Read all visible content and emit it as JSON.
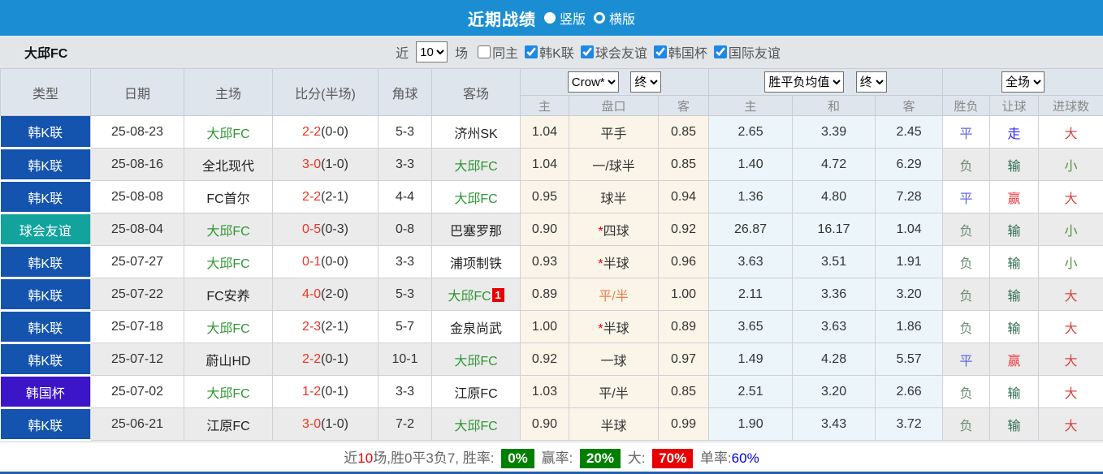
{
  "topbar": {
    "title": "近期战绩",
    "options": [
      {
        "label": "竖版",
        "selected": true
      },
      {
        "label": "横版",
        "selected": false
      }
    ]
  },
  "filterbar": {
    "team": "大邱FC",
    "near_label": "近",
    "near_value": "10",
    "games_label": "场",
    "checkboxes": [
      {
        "label": "同主",
        "checked": false
      },
      {
        "label": "韩K联",
        "checked": true
      },
      {
        "label": "球会友谊",
        "checked": true
      },
      {
        "label": "韩国杯",
        "checked": true
      },
      {
        "label": "国际友谊",
        "checked": true
      }
    ]
  },
  "table": {
    "main_headers": [
      "类型",
      "日期",
      "主场",
      "比分(半场)",
      "角球",
      "客场"
    ],
    "selects": {
      "company": "Crow*",
      "company_period": "终",
      "average": "胜平负均值",
      "average_period": "终",
      "scope": "全场"
    },
    "sub_headers": [
      "主",
      "盘口",
      "客",
      "主",
      "和",
      "客",
      "胜负",
      "让球",
      "进球数"
    ],
    "type_colors": {
      "韩K联": "#1453ae",
      "球会友谊": "#12a39c",
      "韩国杯": "#3d15c8"
    },
    "result_colors": {
      "平": "#6268e0",
      "负": "#6e8c72",
      "走": "#2b2bf0",
      "输": "#2f6e52",
      "赢": "#e8414d",
      "大": "#de4040",
      "小": "#52923e"
    },
    "rows": [
      {
        "type": "韩K联",
        "date": "25-08-23",
        "home": "大邱FC",
        "home_green": true,
        "score": "2-2",
        "half": "(0-0)",
        "corner": "5-3",
        "away": "济州SK",
        "away_green": false,
        "away_badge": "",
        "h_odds": "1.04",
        "handicap": "平手",
        "handicap_star": false,
        "handicap_orange": false,
        "a_odds": "0.85",
        "avg_h": "2.65",
        "avg_d": "3.39",
        "avg_a": "2.45",
        "result": "平",
        "handicap_result": "走",
        "goals": "大"
      },
      {
        "type": "韩K联",
        "date": "25-08-16",
        "home": "全北现代",
        "home_green": false,
        "score": "3-0",
        "half": "(1-0)",
        "corner": "3-3",
        "away": "大邱FC",
        "away_green": true,
        "away_badge": "",
        "h_odds": "1.04",
        "handicap": "一/球半",
        "handicap_star": false,
        "handicap_orange": false,
        "a_odds": "0.85",
        "avg_h": "1.40",
        "avg_d": "4.72",
        "avg_a": "6.29",
        "result": "负",
        "handicap_result": "输",
        "goals": "小"
      },
      {
        "type": "韩K联",
        "date": "25-08-08",
        "home": "FC首尔",
        "home_green": false,
        "score": "2-2",
        "half": "(2-1)",
        "corner": "4-4",
        "away": "大邱FC",
        "away_green": true,
        "away_badge": "",
        "h_odds": "0.95",
        "handicap": "球半",
        "handicap_star": false,
        "handicap_orange": false,
        "a_odds": "0.94",
        "avg_h": "1.36",
        "avg_d": "4.80",
        "avg_a": "7.28",
        "result": "平",
        "handicap_result": "赢",
        "goals": "大"
      },
      {
        "type": "球会友谊",
        "date": "25-08-04",
        "home": "大邱FC",
        "home_green": true,
        "score": "0-5",
        "half": "(0-3)",
        "corner": "0-8",
        "away": "巴塞罗那",
        "away_green": false,
        "away_badge": "",
        "h_odds": "0.90",
        "handicap": "四球",
        "handicap_star": true,
        "handicap_orange": false,
        "a_odds": "0.92",
        "avg_h": "26.87",
        "avg_d": "16.17",
        "avg_a": "1.04",
        "result": "负",
        "handicap_result": "输",
        "goals": "小"
      },
      {
        "type": "韩K联",
        "date": "25-07-27",
        "home": "大邱FC",
        "home_green": true,
        "score": "0-1",
        "half": "(0-0)",
        "corner": "3-3",
        "away": "浦项制铁",
        "away_green": false,
        "away_badge": "",
        "h_odds": "0.93",
        "handicap": "半球",
        "handicap_star": true,
        "handicap_orange": false,
        "a_odds": "0.96",
        "avg_h": "3.63",
        "avg_d": "3.51",
        "avg_a": "1.91",
        "result": "负",
        "handicap_result": "输",
        "goals": "小"
      },
      {
        "type": "韩K联",
        "date": "25-07-22",
        "home": "FC安养",
        "home_green": false,
        "score": "4-0",
        "half": "(2-0)",
        "corner": "5-3",
        "away": "大邱FC",
        "away_green": true,
        "away_badge": "1",
        "h_odds": "0.89",
        "handicap": "平/半",
        "handicap_star": false,
        "handicap_orange": true,
        "a_odds": "1.00",
        "avg_h": "2.11",
        "avg_d": "3.36",
        "avg_a": "3.20",
        "result": "负",
        "handicap_result": "输",
        "goals": "大"
      },
      {
        "type": "韩K联",
        "date": "25-07-18",
        "home": "大邱FC",
        "home_green": true,
        "score": "2-3",
        "half": "(2-1)",
        "corner": "5-7",
        "away": "金泉尚武",
        "away_green": false,
        "away_badge": "",
        "h_odds": "1.00",
        "handicap": "半球",
        "handicap_star": true,
        "handicap_orange": false,
        "a_odds": "0.89",
        "avg_h": "3.65",
        "avg_d": "3.63",
        "avg_a": "1.86",
        "result": "负",
        "handicap_result": "输",
        "goals": "大"
      },
      {
        "type": "韩K联",
        "date": "25-07-12",
        "home": "蔚山HD",
        "home_green": false,
        "score": "2-2",
        "half": "(0-1)",
        "corner": "10-1",
        "away": "大邱FC",
        "away_green": true,
        "away_badge": "",
        "h_odds": "0.92",
        "handicap": "一球",
        "handicap_star": false,
        "handicap_orange": false,
        "a_odds": "0.97",
        "avg_h": "1.49",
        "avg_d": "4.28",
        "avg_a": "5.57",
        "result": "平",
        "handicap_result": "赢",
        "goals": "大"
      },
      {
        "type": "韩国杯",
        "date": "25-07-02",
        "home": "大邱FC",
        "home_green": true,
        "score": "1-2",
        "half": "(0-1)",
        "corner": "3-3",
        "away": "江原FC",
        "away_green": false,
        "away_badge": "",
        "h_odds": "1.03",
        "handicap": "平/半",
        "handicap_star": false,
        "handicap_orange": false,
        "a_odds": "0.85",
        "avg_h": "2.51",
        "avg_d": "3.20",
        "avg_a": "2.66",
        "result": "负",
        "handicap_result": "输",
        "goals": "大"
      },
      {
        "type": "韩K联",
        "date": "25-06-21",
        "home": "江原FC",
        "home_green": false,
        "score": "3-0",
        "half": "(1-0)",
        "corner": "7-2",
        "away": "大邱FC",
        "away_green": true,
        "away_badge": "",
        "h_odds": "0.90",
        "handicap": "半球",
        "handicap_star": false,
        "handicap_orange": false,
        "a_odds": "0.99",
        "avg_h": "1.90",
        "avg_d": "3.43",
        "avg_a": "3.72",
        "result": "负",
        "handicap_result": "输",
        "goals": "大"
      }
    ]
  },
  "summary": {
    "parts": [
      {
        "t": "近",
        "c": "#666666"
      },
      {
        "t": "10",
        "c": "#ee0000"
      },
      {
        "t": "场,胜0平3负7, ",
        "c": "#666666"
      },
      {
        "t": "胜率: ",
        "c": "#666666"
      },
      {
        "t": "0%",
        "c": "#ffffff",
        "bg": "#008000",
        "badge": true
      },
      {
        "t": " 赢率: ",
        "c": "#666666"
      },
      {
        "t": "20%",
        "c": "#ffffff",
        "bg": "#008000",
        "badge": true
      },
      {
        "t": " 大: ",
        "c": "#666666"
      },
      {
        "t": "70%",
        "c": "#ffffff",
        "bg": "#e80000",
        "badge": true
      },
      {
        "t": " 单率:",
        "c": "#666666"
      },
      {
        "t": "60%",
        "c": "#0000dd"
      }
    ]
  }
}
